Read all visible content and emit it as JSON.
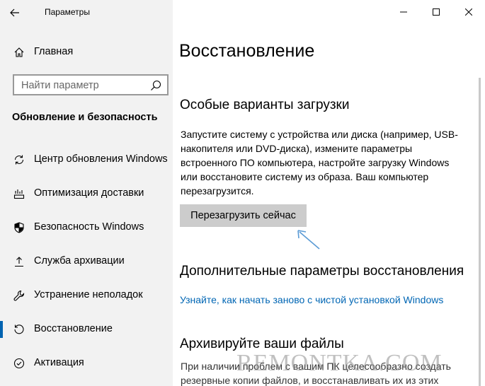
{
  "window": {
    "title": "Параметры"
  },
  "sidebar": {
    "home_label": "Главная",
    "search_placeholder": "Найти параметр",
    "section_title": "Обновление и безопасность",
    "items": [
      {
        "label": "Центр обновления Windows",
        "icon": "sync-icon"
      },
      {
        "label": "Оптимизация доставки",
        "icon": "delivery-icon"
      },
      {
        "label": "Безопасность Windows",
        "icon": "shield-icon"
      },
      {
        "label": "Служба архивации",
        "icon": "backup-icon"
      },
      {
        "label": "Устранение неполадок",
        "icon": "wrench-icon"
      },
      {
        "label": "Восстановление",
        "icon": "recovery-icon",
        "active": true
      },
      {
        "label": "Активация",
        "icon": "activation-icon"
      }
    ]
  },
  "main": {
    "title": "Восстановление",
    "special_boot": {
      "heading": "Особые варианты загрузки",
      "lines": [
        "Запустите систему с устройства или диска (например, USB-",
        "накопителя или DVD-диска), измените параметры",
        "встроенного ПО компьютера, настройте загрузку Windows",
        "или восстановите систему из образа. Ваш компьютер",
        "перезагрузится."
      ],
      "button_label": "Перезагрузить сейчас"
    },
    "advanced": {
      "heading": "Дополнительные параметры восстановления",
      "link": "Узнайте, как начать заново с чистой установкой Windows"
    },
    "archive": {
      "heading": "Архивируйте ваши файлы",
      "lines": [
        "При наличии проблем с вашим ПК целесообразно создать",
        "резервные копии файлов, и восстанавливать их из этих"
      ]
    }
  },
  "watermark": "REMONTKA.COM",
  "colors": {
    "accent": "#0063b1",
    "link": "#0066b4",
    "sidebar_bg": "#f2f2f2",
    "button_bg": "#cccccc",
    "annotation_arrow": "#5b9bd5"
  }
}
